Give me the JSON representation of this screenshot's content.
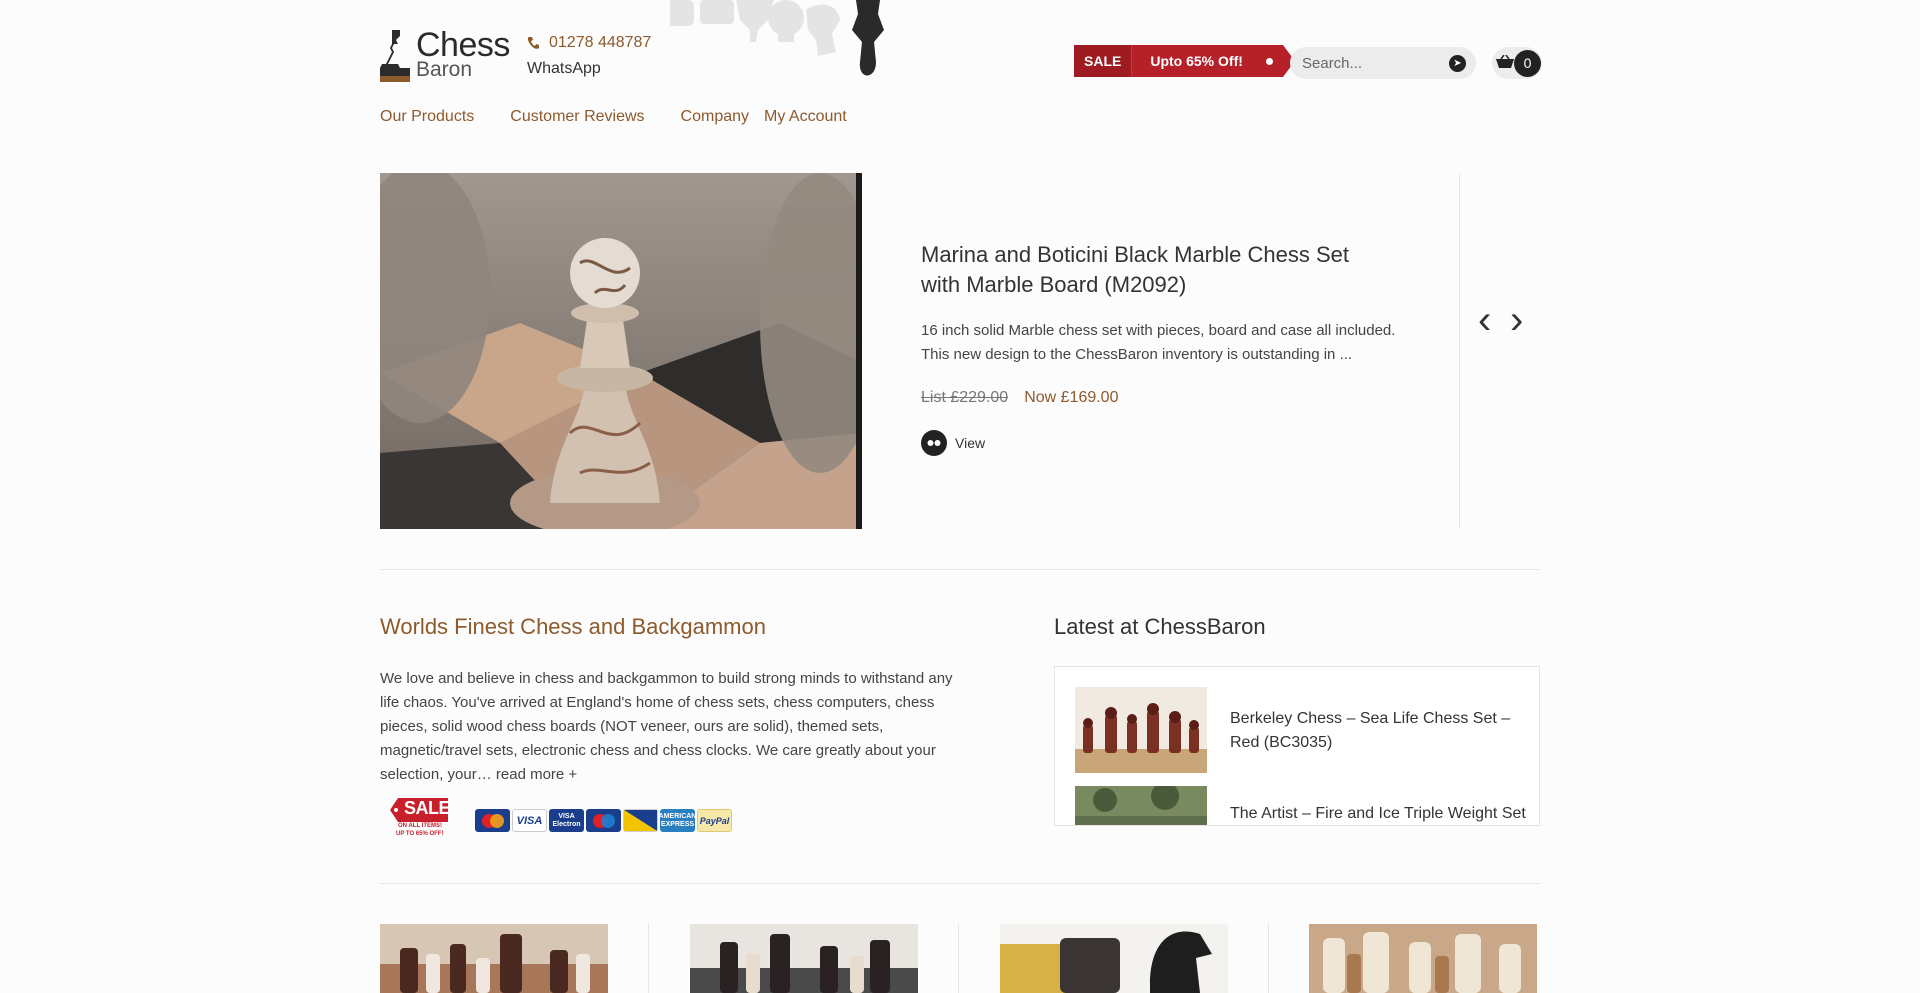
{
  "header": {
    "logo": {
      "line1": "Chess",
      "line2": "Baron"
    },
    "phone": "01278 448787",
    "whatsapp": "WhatsApp",
    "sale_tag": "SALE",
    "sale_text": "Upto 65% Off!",
    "search_placeholder": "Search...",
    "cart_count": "0"
  },
  "nav": {
    "items": [
      {
        "label": "Our Products"
      },
      {
        "label": "Customer Reviews"
      },
      {
        "label": "Company"
      },
      {
        "label": "My Account"
      }
    ]
  },
  "hero": {
    "title": "Marina and Boticini Black Marble Chess Set with Marble Board (M2092)",
    "description": "16 inch solid Marble chess set with pieces, board and case all included. This new design to the ChessBaron inventory is outstanding in ...",
    "price_list": "List £229.00",
    "price_now": "Now £169.00",
    "view_label": "View"
  },
  "about": {
    "title": "Worlds Finest Chess and Backgammon",
    "text": "We love and believe in chess and backgammon to build strong minds to withstand any life chaos. You've arrived at England's home of chess sets, chess computers, chess pieces, solid wood chess boards (NOT veneer, ours are solid), themed sets, magnetic/travel sets, electronic chess and chess clocks. We care greatly about your selection, your…",
    "read_more": "read more +",
    "sale_badge": {
      "title": "SALE",
      "line1": "ON ALL ITEMS!",
      "line2": "UP TO 65% OFF!"
    },
    "payment_cards": [
      {
        "name": "MasterCard",
        "color": "#e8a33a"
      },
      {
        "name": "VISA",
        "color": "#ffffff"
      },
      {
        "name": "VISA Electron",
        "color": "#1a3e8c"
      },
      {
        "name": "Maestro",
        "color": "#1a3e8c"
      },
      {
        "name": "DELTA",
        "color": "#1a3e8c"
      },
      {
        "name": "AMERICAN EXPRESS",
        "color": "#2a7fc0"
      },
      {
        "name": "PayPal",
        "color": "#f5e8a8"
      }
    ]
  },
  "latest": {
    "title": "Latest at ChessBaron",
    "items": [
      {
        "label": "Berkeley Chess – Sea Life Chess Set – Red (BC3035)"
      },
      {
        "label": "The Artist – Fire and Ice Triple Weight Set"
      }
    ]
  },
  "colors": {
    "accent": "#8c5a2b",
    "sale_red": "#b52029",
    "dark": "#222222"
  }
}
